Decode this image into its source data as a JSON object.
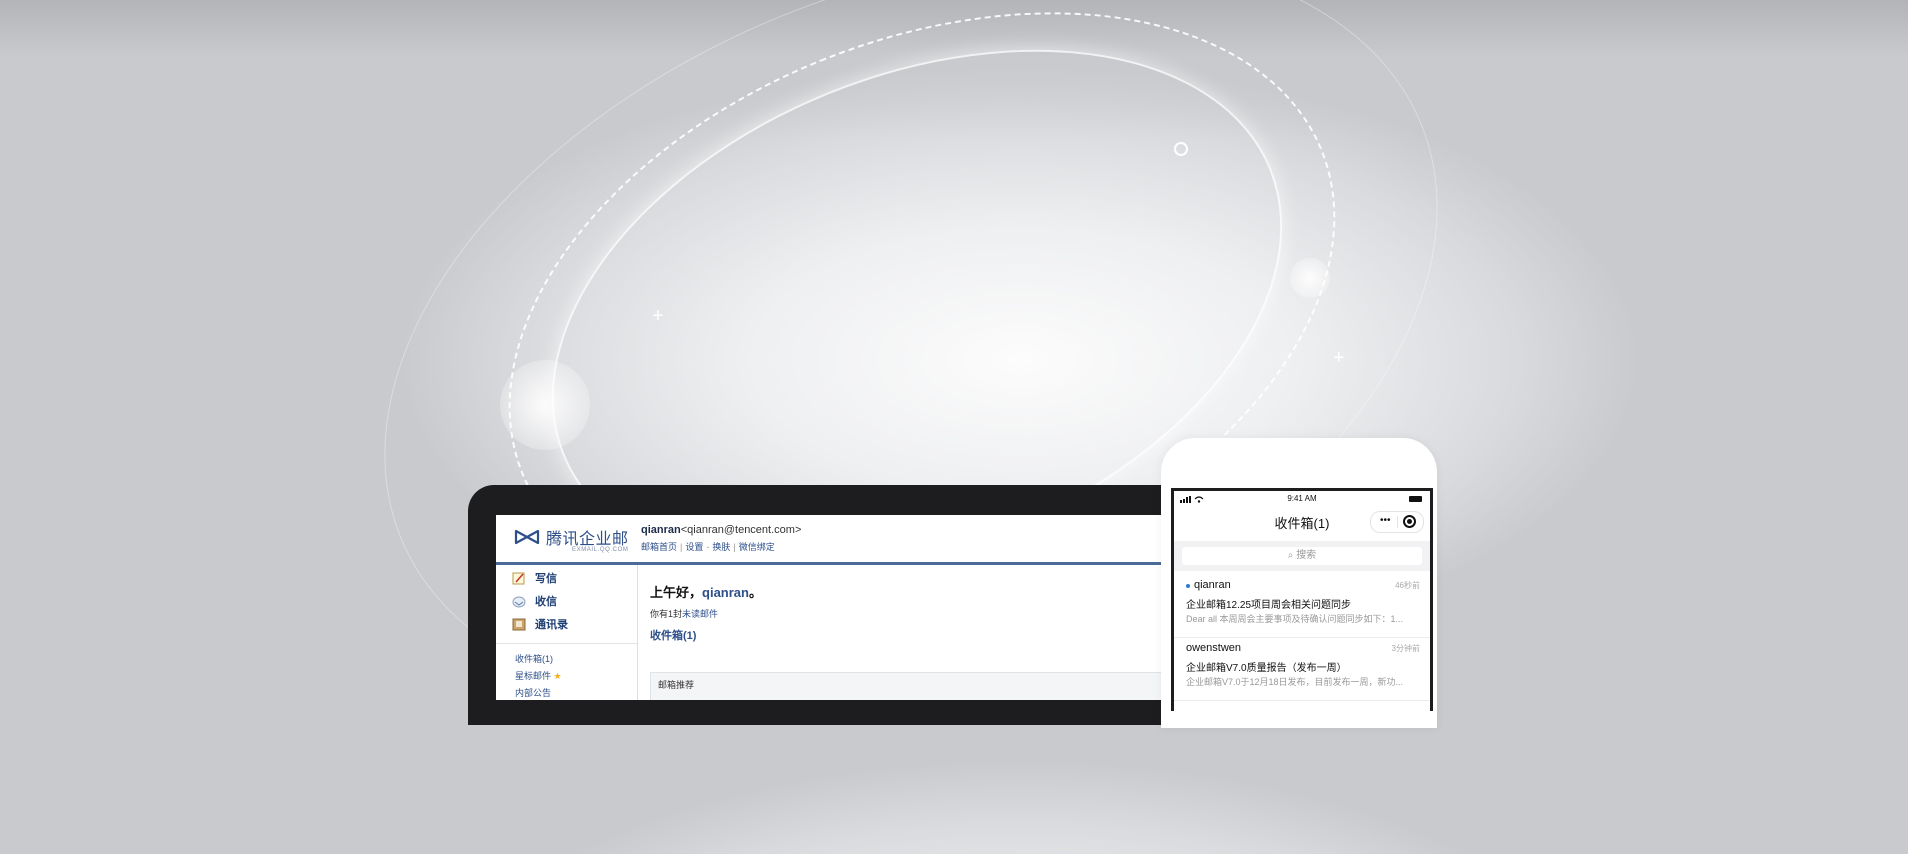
{
  "desktop": {
    "brand": "腾讯企业邮",
    "brand_domain": "EXMAIL.QQ.COM",
    "user_name": "qianran",
    "user_email": "<qianran@tencent.com>",
    "links": [
      "邮箱首页",
      "设置",
      "换肤",
      "微信绑定"
    ],
    "link_seps": [
      "|",
      "-",
      "|"
    ],
    "sidebar": {
      "actions": [
        {
          "label": "写信",
          "icon": "compose-icon"
        },
        {
          "label": "收信",
          "icon": "inbox-icon"
        },
        {
          "label": "通讯录",
          "icon": "contacts-icon"
        }
      ],
      "folders": [
        "收件箱(1)",
        "星标邮件",
        "内部公告"
      ]
    },
    "greeting_prefix": "上午好，",
    "greeting_name": "qianran",
    "greeting_suffix": "。",
    "unread_prefix": "你有1封",
    "unread_link": "未读邮件",
    "inbox_link": "收件箱(1)",
    "recommend_title": "邮箱推荐"
  },
  "mobile": {
    "status_time": "9:41 AM",
    "title": "收件箱(1)",
    "capsule_more": "•••",
    "search_placeholder": "搜索",
    "mails": [
      {
        "from": "qianran",
        "time": "46秒前",
        "subject": "企业邮箱12.25项目周会相关问题同步",
        "preview": "Dear all 本周周会主要事项及待确认问题同步如下：1...",
        "unread": true
      },
      {
        "from": "owenstwen",
        "time": "3分钟前",
        "subject": "企业邮箱V7.0质量报告（发布一周）",
        "preview": "企业邮箱V7.0于12月18日发布，目前发布一周，新功...",
        "unread": false
      }
    ]
  },
  "colors": {
    "accent": "#2d4f8a",
    "header_rule": "#4b6c99",
    "unread_dot": "#2a7bd8",
    "device_frame": "#1d1d1f"
  }
}
